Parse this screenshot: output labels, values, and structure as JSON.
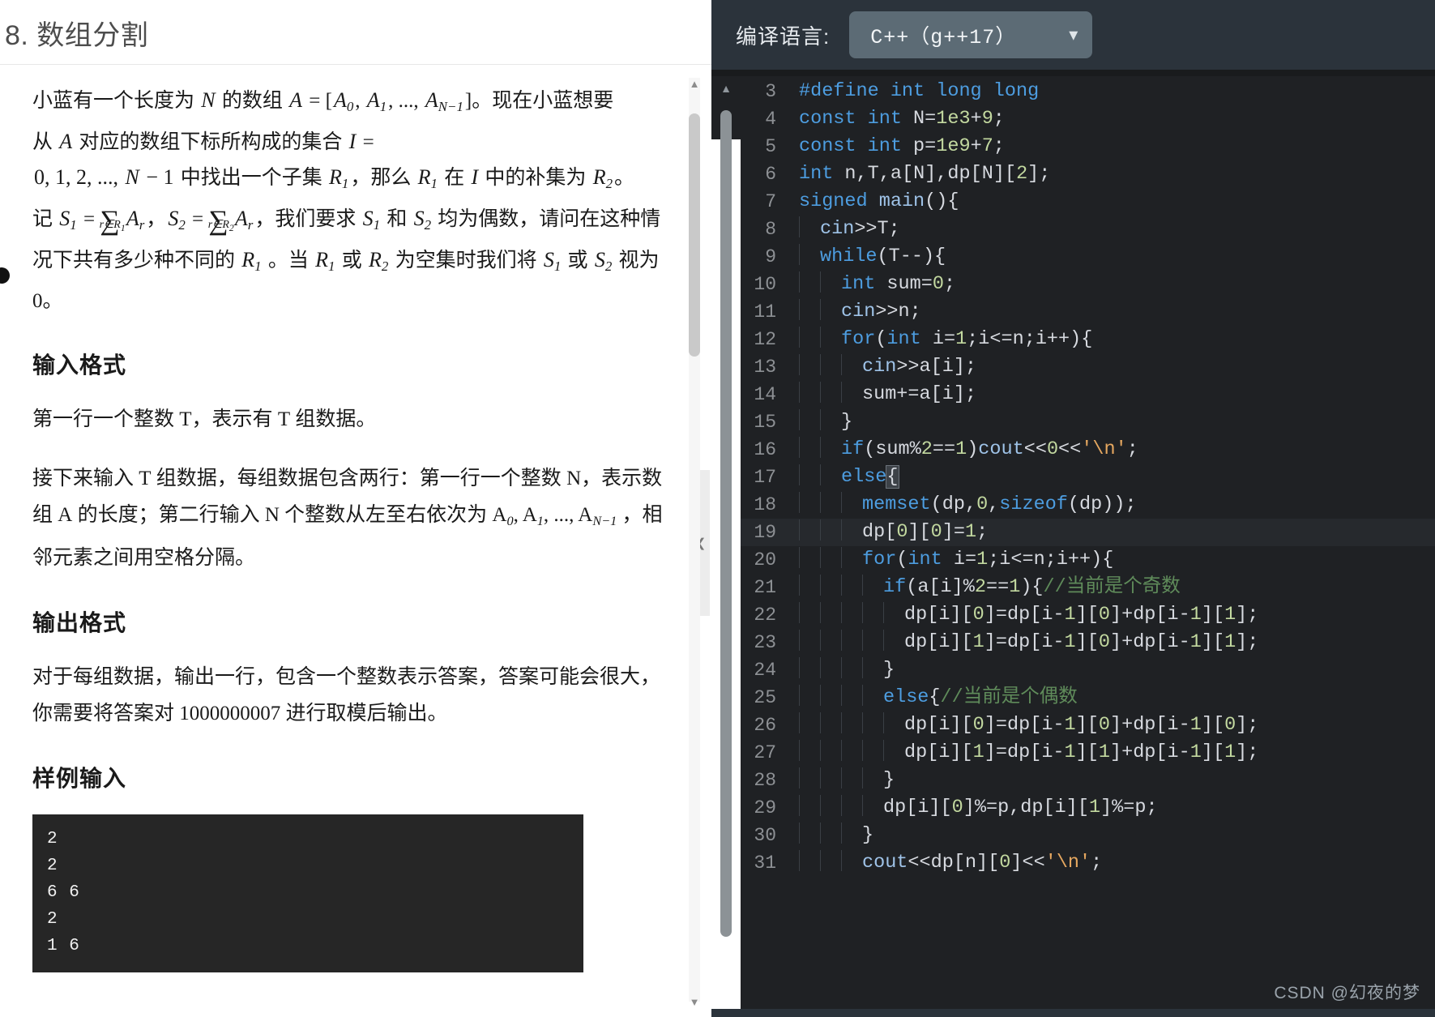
{
  "problem": {
    "title": "8. 数组分割",
    "statement_lines": [
      "小蓝有一个长度为 N 的数组 A = [A0, A1, ..., AN−1]。现在小蓝想要从 A 对应的数组下标所构成的集合 I = 0, 1, 2, ..., N − 1 中找出一个子集 R1，那么 R1 在 I 中的补集为 R2。记 S1 = Σr∈R1 Ar，S2 = Σr∈R2 Ar，我们要求 S1 和 S2 均为偶数，请问在这种情况下共有多少种不同的 R1。当 R1 或 R2 为空集时我们将 S1 或 S2 视为 0。"
    ],
    "sections": [
      {
        "heading": "输入格式",
        "paragraphs": [
          "第一行一个整数 T，表示有 T 组数据。",
          "接下来输入 T 组数据，每组数据包含两行：第一行一个整数 N，表示数组 A 的长度；第二行输入 N 个整数从左至右依次为 A0, A1, ..., AN−1，相邻元素之间用空格分隔。"
        ]
      },
      {
        "heading": "输出格式",
        "paragraphs": [
          "对于每组数据，输出一行，包含一个整数表示答案，答案可能会很大，你需要将答案对 1000000007 进行取模后输出。"
        ]
      },
      {
        "heading": "样例输入",
        "paragraphs": []
      }
    ],
    "modulus": "1000000007",
    "sample_input": "2\n2\n6 6\n2\n1 6"
  },
  "editor": {
    "toolbar_label": "编译语言:",
    "language_value": "C++（g++17）",
    "dropdown_icon": "chevron-down-icon",
    "watermark": "CSDN @幻夜的梦",
    "current_line": 19,
    "lines": [
      {
        "no": "3",
        "indent": 0,
        "text": "#define int long long"
      },
      {
        "no": "4",
        "indent": 0,
        "text": "const int N=1e3+9;"
      },
      {
        "no": "5",
        "indent": 0,
        "text": "const int p=1e9+7;"
      },
      {
        "no": "6",
        "indent": 0,
        "text": "int n,T,a[N],dp[N][2];"
      },
      {
        "no": "7",
        "indent": 0,
        "text": "signed main(){"
      },
      {
        "no": "8",
        "indent": 1,
        "text": "cin>>T;"
      },
      {
        "no": "9",
        "indent": 1,
        "text": "while(T--){"
      },
      {
        "no": "10",
        "indent": 2,
        "text": "int sum=0;"
      },
      {
        "no": "11",
        "indent": 2,
        "text": "cin>>n;"
      },
      {
        "no": "12",
        "indent": 2,
        "text": "for(int i=1;i<=n;i++){"
      },
      {
        "no": "13",
        "indent": 3,
        "text": "cin>>a[i];"
      },
      {
        "no": "14",
        "indent": 3,
        "text": "sum+=a[i];"
      },
      {
        "no": "15",
        "indent": 2,
        "text": "}"
      },
      {
        "no": "16",
        "indent": 2,
        "text": "if(sum%2==1)cout<<0<<'\\n';"
      },
      {
        "no": "17",
        "indent": 2,
        "text": "else{"
      },
      {
        "no": "18",
        "indent": 3,
        "text": "memset(dp,0,sizeof(dp));"
      },
      {
        "no": "19",
        "indent": 3,
        "text": "dp[0][0]=1;"
      },
      {
        "no": "20",
        "indent": 3,
        "text": "for(int i=1;i<=n;i++){"
      },
      {
        "no": "21",
        "indent": 4,
        "text": "if(a[i]%2==1){//当前是个奇数"
      },
      {
        "no": "22",
        "indent": 5,
        "text": "dp[i][0]=dp[i-1][0]+dp[i-1][1];"
      },
      {
        "no": "23",
        "indent": 5,
        "text": "dp[i][1]=dp[i-1][0]+dp[i-1][1];"
      },
      {
        "no": "24",
        "indent": 4,
        "text": "}"
      },
      {
        "no": "25",
        "indent": 4,
        "text": "else{//当前是个偶数"
      },
      {
        "no": "26",
        "indent": 5,
        "text": "dp[i][0]=dp[i-1][0]+dp[i-1][0];"
      },
      {
        "no": "27",
        "indent": 5,
        "text": "dp[i][1]=dp[i-1][1]+dp[i-1][1];"
      },
      {
        "no": "28",
        "indent": 4,
        "text": "}"
      },
      {
        "no": "29",
        "indent": 4,
        "text": "dp[i][0]%=p,dp[i][1]%=p;"
      },
      {
        "no": "30",
        "indent": 3,
        "text": "}"
      },
      {
        "no": "31",
        "indent": 3,
        "text": "cout<<dp[n][0]<<'\\n';"
      }
    ]
  },
  "colors": {
    "editor_bg": "#1f2124",
    "toolbar_bg": "#2b333b",
    "select_bg": "#5c6b75",
    "keyword": "#4d9de0",
    "number": "#c3d9a0",
    "string": "#e6a860",
    "comment": "#5f8b5a",
    "code_text": "#d7dae0",
    "sample_bg": "#262626"
  }
}
